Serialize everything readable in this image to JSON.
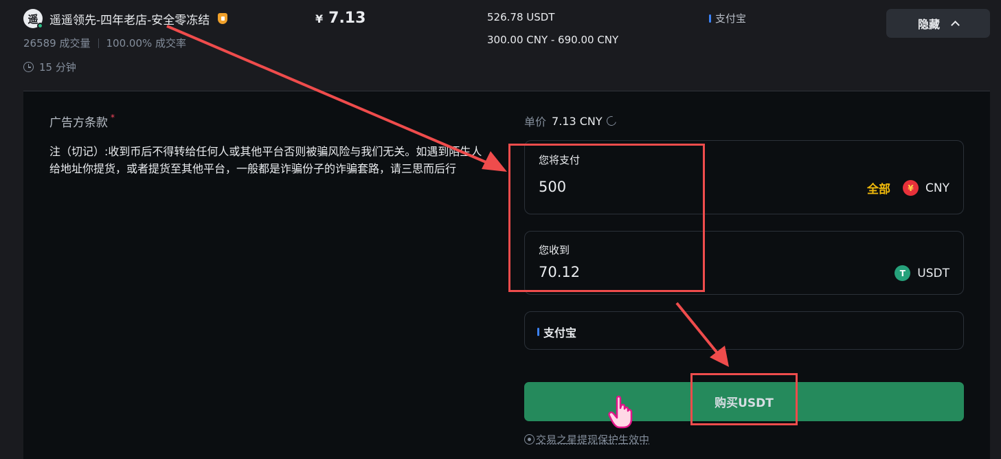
{
  "merchant": {
    "avatar_char": "遥",
    "name": "遥遥领先-四年老店-安全零冻结",
    "trades": "26589 成交量",
    "completion": "100.00% 成交率",
    "pay_time": "15 分钟"
  },
  "offer": {
    "currency_symbol": "¥",
    "price": "7.13",
    "available": "526.78 USDT",
    "limit": "300.00 CNY - 690.00 CNY",
    "payment_method": "支付宝"
  },
  "hide_button": {
    "label": "隐藏"
  },
  "terms": {
    "title": "广告方条款",
    "required_mark": "*",
    "text": "注（切记）:收到币后不得转给任何人或其他平台否则被骗风险与我们无关。如遇到陌生人给地址你提货，或者提货至其他平台，一般都是诈骗份子的诈骗套路，请三思而后行"
  },
  "order": {
    "unit_price_label": "单价",
    "unit_price_value": "7.13 CNY",
    "pay": {
      "label": "您将支付",
      "value": "500",
      "all_label": "全部",
      "currency": "CNY",
      "currency_icon_glyph": "¥"
    },
    "receive": {
      "label": "您收到",
      "value": "70.12",
      "currency": "USDT",
      "currency_icon_glyph": "T"
    },
    "payment_method": "支付宝",
    "buy_button": "购买USDT",
    "protection_note": "交易之星提现保护生效中"
  },
  "colors": {
    "background": "#1a1b1f",
    "panel": "#0b0e11",
    "buy_green": "#258a5c",
    "accent_yellow": "#f0b90b",
    "annotation_red": "#ef4c4c",
    "alipay_blue": "#3b82f6"
  },
  "icons": [
    "online-status-icon",
    "shield-badge-icon",
    "clock-icon",
    "chevron-up-icon",
    "refresh-icon",
    "cny-coin-icon",
    "usdt-coin-icon",
    "hand-cursor-icon",
    "protection-icon"
  ]
}
